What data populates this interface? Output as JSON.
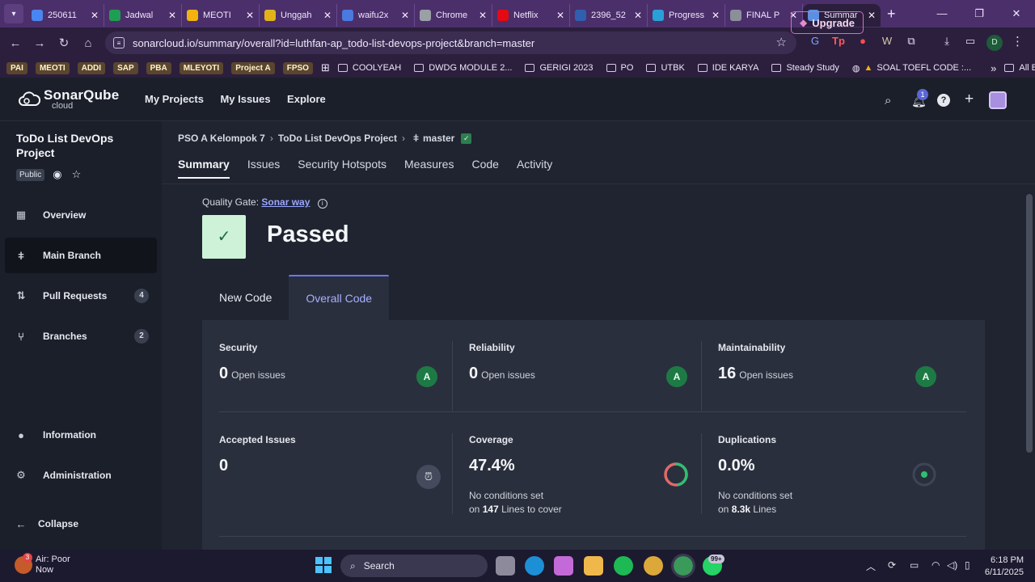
{
  "browser": {
    "tabs": [
      {
        "label": "250611",
        "icon": "docs-icon",
        "color": "#4a86f0"
      },
      {
        "label": "Jadwal",
        "icon": "sheets-icon",
        "color": "#1e9e52"
      },
      {
        "label": "MEOTI",
        "icon": "drive-icon",
        "color": "#f2b20f"
      },
      {
        "label": "Unggah",
        "icon": "upload-icon",
        "color": "#e0b31a"
      },
      {
        "label": "waifu2x",
        "icon": "waifu-icon",
        "color": "#4a7ae0"
      },
      {
        "label": "Chrome",
        "icon": "chrome-icon",
        "color": "#9aa0a6"
      },
      {
        "label": "Netflix",
        "icon": "netflix-icon",
        "color": "#e50914"
      },
      {
        "label": "2396_52",
        "icon": "its-icon",
        "color": "#2f5fae"
      },
      {
        "label": "Progress",
        "icon": "progress-icon",
        "color": "#2aa0d8"
      },
      {
        "label": "FINAL P",
        "icon": "globe-icon",
        "color": "#8a8f99"
      },
      {
        "label": "Summar",
        "icon": "sonar-icon",
        "color": "#5c8fe0",
        "active": true
      }
    ],
    "url": "sonarcloud.io/summary/overall?id=luthfan-ap_todo-list-devops-project&branch=master",
    "profile_initial": "D",
    "bookmarks": {
      "pills": [
        "PAI",
        "MEOTI",
        "ADDI",
        "SAP",
        "PBA",
        "MLEYOTI",
        "Project A",
        "FPSO"
      ],
      "folders": [
        "COOLYEAH",
        "DWDG MODULE 2...",
        "GERIGI 2023",
        "PO",
        "UTBK",
        "IDE KARYA",
        "Steady Study"
      ],
      "link": "SOAL TOEFL CODE :...",
      "more": "»",
      "all": "All Bookmarks"
    }
  },
  "header": {
    "logo_main": "SonarQube",
    "logo_sub": "cloud",
    "nav": [
      "My Projects",
      "My Issues",
      "Explore"
    ],
    "upgrade": "Upgrade",
    "notif_count": "1"
  },
  "sidebar": {
    "project_title": "ToDo List DevOps Project",
    "public": "Public",
    "items": [
      {
        "label": "Overview",
        "icon": "overview-icon",
        "glyph": "▦"
      },
      {
        "label": "Main Branch",
        "icon": "branch-icon",
        "glyph": "ǂ",
        "active": true
      },
      {
        "label": "Pull Requests",
        "icon": "pull-request-icon",
        "glyph": "⇅",
        "count": "4"
      },
      {
        "label": "Branches",
        "icon": "branches-icon",
        "glyph": "⑂",
        "count": "2"
      }
    ],
    "information": "Information",
    "administration": "Administration",
    "collapse": "Collapse"
  },
  "main": {
    "breadcrumb": {
      "org": "PSO A Kelompok 7",
      "project": "ToDo List DevOps Project",
      "branch": "master"
    },
    "tabs": [
      "Summary",
      "Issues",
      "Security Hotspots",
      "Measures",
      "Code",
      "Activity"
    ],
    "quality_gate": {
      "label": "Quality Gate:",
      "name": "Sonar way",
      "status": "Passed"
    },
    "code_tabs": [
      "New Code",
      "Overall Code"
    ],
    "metrics": {
      "security": {
        "title": "Security",
        "value": "0",
        "unit": "Open issues",
        "grade": "A"
      },
      "reliability": {
        "title": "Reliability",
        "value": "0",
        "unit": "Open issues",
        "grade": "A"
      },
      "maintainability": {
        "title": "Maintainability",
        "value": "16",
        "unit": "Open issues",
        "grade": "A"
      },
      "accepted": {
        "title": "Accepted Issues",
        "value": "0"
      },
      "coverage": {
        "title": "Coverage",
        "value": "47.4%",
        "percent": 47.4,
        "sub1": "No conditions set",
        "sub2_pre": "on",
        "sub2_num": "147",
        "sub2_post": "Lines to cover"
      },
      "duplications": {
        "title": "Duplications",
        "value": "0.0%",
        "sub1": "No conditions set",
        "sub2_pre": "on",
        "sub2_num": "8.3k",
        "sub2_post": "Lines"
      }
    }
  },
  "taskbar": {
    "weather_title": "Air: Poor",
    "weather_sub": "Now",
    "weather_badge": "3",
    "search": "Search",
    "badge": "99+",
    "time": "6:18 PM",
    "date": "6/11/2025"
  }
}
